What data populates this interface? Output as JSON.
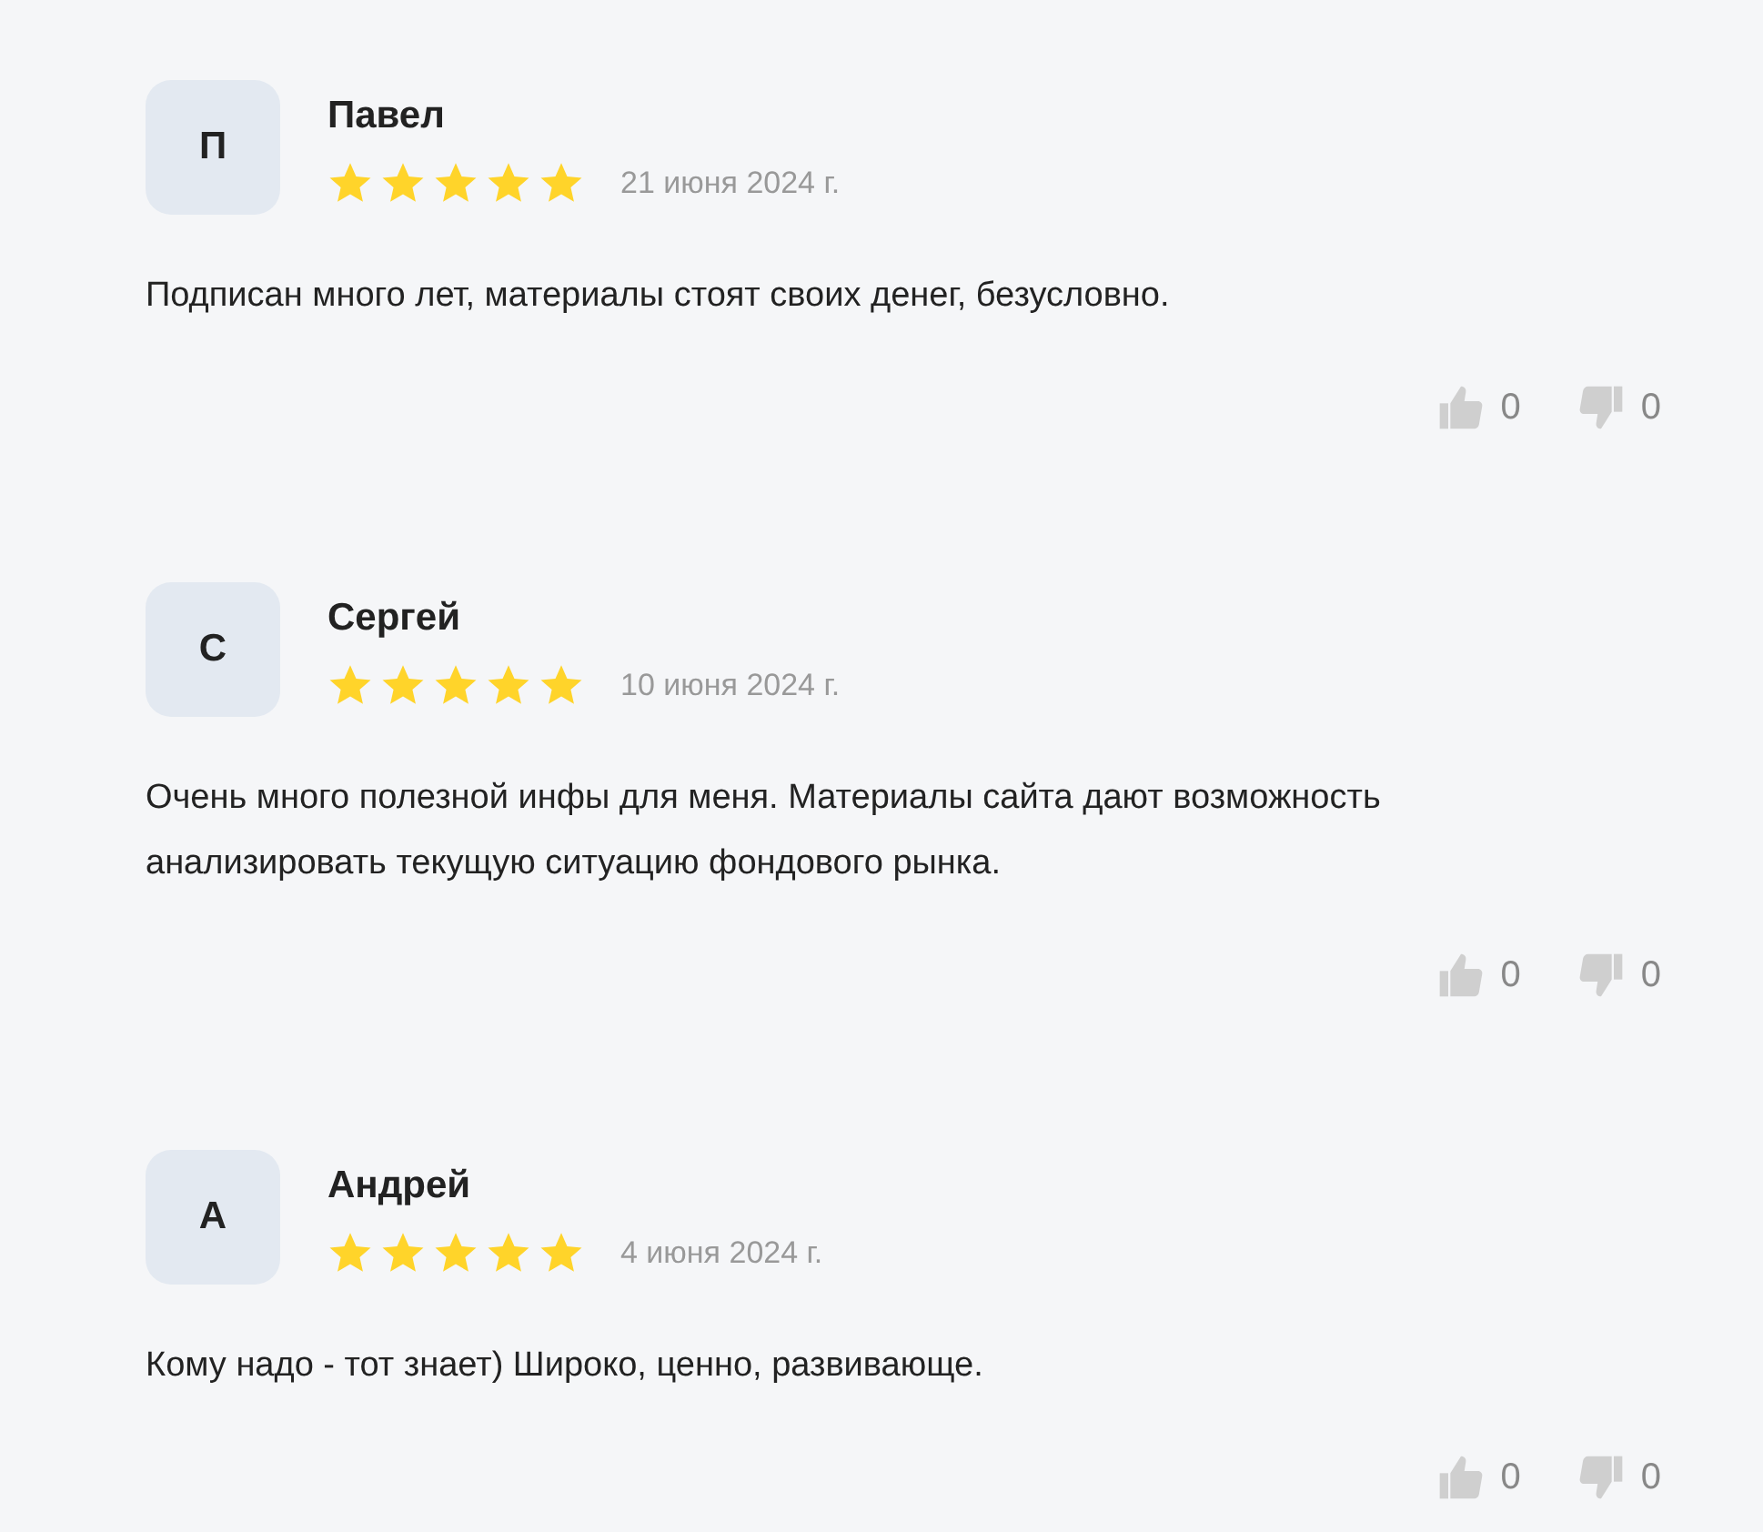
{
  "reviews": [
    {
      "initial": "П",
      "name": "Павел",
      "stars": 5,
      "date": "21 июня 2024 г.",
      "text": "Подписан много лет, материалы стоят своих денег, безусловно.",
      "likes": "0",
      "dislikes": "0"
    },
    {
      "initial": "С",
      "name": "Сергей",
      "stars": 5,
      "date": "10 июня 2024 г.",
      "text": "Очень много полезной инфы для меня. Материалы сайта дают возможность анализировать текущую ситуацию фондового рынка.",
      "likes": "0",
      "dislikes": "0"
    },
    {
      "initial": "А",
      "name": "Андрей",
      "stars": 5,
      "date": "4 июня 2024 г.",
      "text": "Кому надо - тот знает) Широко, ценно, развивающе.",
      "likes": "0",
      "dislikes": "0"
    }
  ]
}
